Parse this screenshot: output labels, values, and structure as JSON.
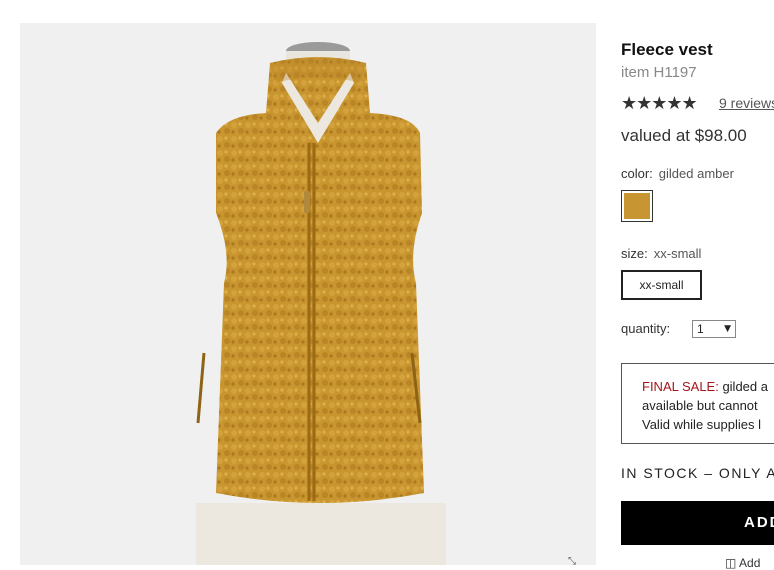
{
  "product": {
    "title": "Fleece vest",
    "item_number": "item H1197",
    "stars": "★★★★★",
    "rating_value": 5,
    "reviews_link": "9 reviews",
    "price": "valued at $98.00"
  },
  "color": {
    "label": "color:",
    "selected": "gilded amber",
    "swatch_color": "#c79532"
  },
  "size": {
    "label": "size:",
    "selected": "xx-small",
    "button_label": "xx-small"
  },
  "quantity": {
    "label": "quantity:",
    "value": "1",
    "arrow": "▼"
  },
  "final_sale": {
    "label": "FINAL SALE:",
    "line1_rest": " gilded a",
    "line2": "available but cannot",
    "line3": "Valid while supplies l"
  },
  "stock": {
    "text": "IN STOCK – ONLY A"
  },
  "add_button": {
    "label": "ADD"
  },
  "wishlist": {
    "label": "Add"
  },
  "zoom": {
    "glyph": "⤡"
  }
}
